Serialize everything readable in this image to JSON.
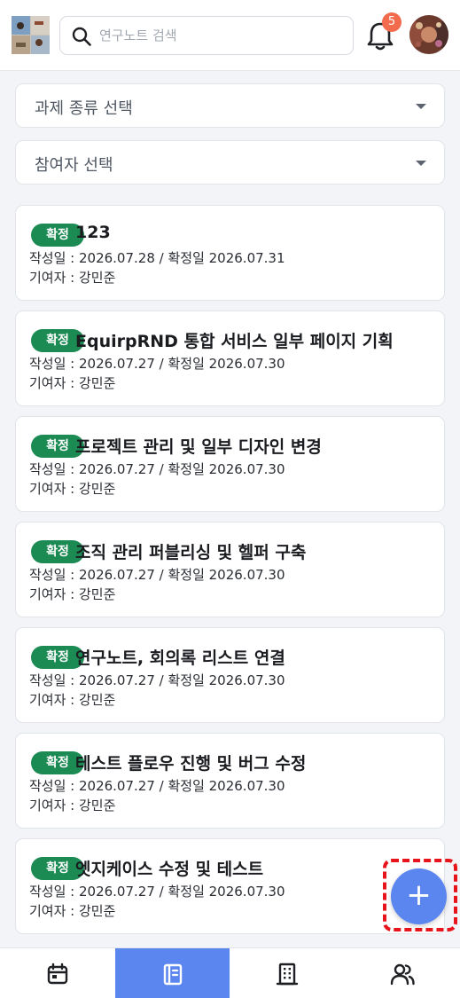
{
  "header": {
    "search_placeholder": "연구노트 검색",
    "notification_count": "5"
  },
  "filters": {
    "project_type_label": "과제 종류 선택",
    "participant_label": "참여자 선택"
  },
  "notes": [
    {
      "status": "확정",
      "title": "123",
      "dates": "작성일 : 2026.07.28 / 확정일 2026.07.31",
      "contributor": "기여자 : 강민준"
    },
    {
      "status": "확정",
      "title": "EquirpRND 통합 서비스 일부 페이지 기획",
      "dates": "작성일 : 2026.07.27 / 확정일 2026.07.30",
      "contributor": "기여자 : 강민준"
    },
    {
      "status": "확정",
      "title": "프로젝트 관리 및 일부 디자인 변경",
      "dates": "작성일 : 2026.07.27 / 확정일 2026.07.30",
      "contributor": "기여자 : 강민준"
    },
    {
      "status": "확정",
      "title": "조직 관리 퍼블리싱 및 헬퍼 구축",
      "dates": "작성일 : 2026.07.27 / 확정일 2026.07.30",
      "contributor": "기여자 : 강민준"
    },
    {
      "status": "확정",
      "title": "연구노트, 회의록 리스트 연결",
      "dates": "작성일 : 2026.07.27 / 확정일 2026.07.30",
      "contributor": "기여자 : 강민준"
    },
    {
      "status": "확정",
      "title": "테스트 플로우 진행 및 버그 수정",
      "dates": "작성일 : 2026.07.27 / 확정일 2026.07.30",
      "contributor": "기여자 : 강민준"
    },
    {
      "status": "확정",
      "title": "엣지케이스 수정 및 테스트",
      "dates": "작성일 : 2026.07.27 / 확정일 2026.07.30",
      "contributor": "기여자 : 강민준"
    }
  ],
  "fab": {
    "label": "+",
    "icon": "plus-icon"
  },
  "bottom_nav": {
    "items": [
      {
        "icon": "calendar-icon",
        "active": false
      },
      {
        "icon": "notebook-icon",
        "active": true
      },
      {
        "icon": "building-icon",
        "active": false
      },
      {
        "icon": "users-icon",
        "active": false
      }
    ]
  },
  "colors": {
    "accent": "#5b86f0",
    "status_badge": "#1b8a53",
    "notification_badge": "#f26b4c",
    "highlight": "#e8141c"
  }
}
